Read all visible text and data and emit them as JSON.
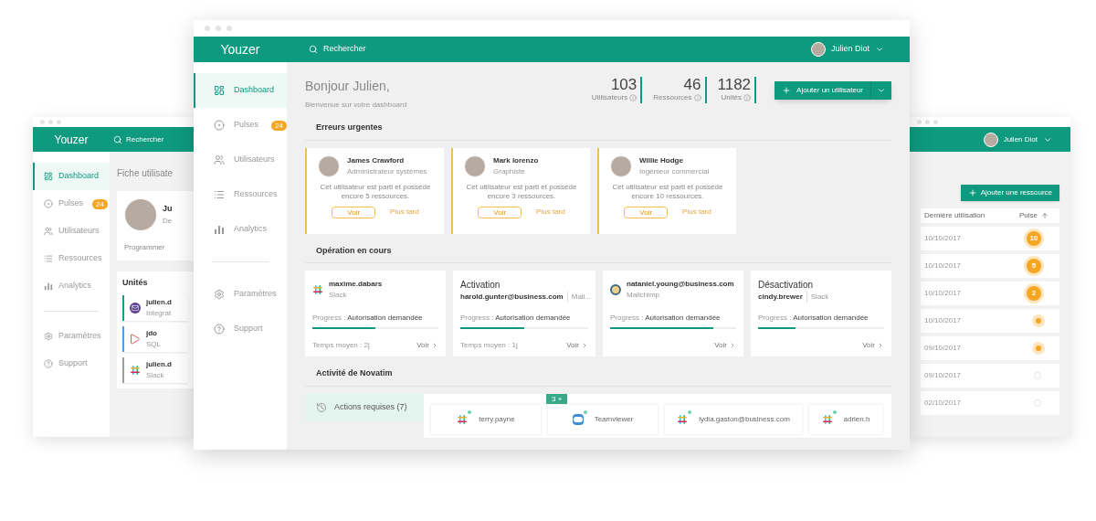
{
  "left_window": {
    "logo": "Youzer",
    "search": "Rechercher",
    "nav": [
      {
        "label": "Dashboard",
        "selected": true
      },
      {
        "label": "Pulses",
        "badge": "24",
        "selected": false
      },
      {
        "label": "Utilisateurs",
        "selected": false
      },
      {
        "label": "Ressources",
        "selected": false
      },
      {
        "label": "Analytics",
        "selected": false
      }
    ],
    "nav_bottom": [
      {
        "label": "Paramètres",
        "selected": false
      },
      {
        "label": "Support",
        "selected": false
      }
    ],
    "page_title": "Fiche utilisate",
    "profile": {
      "name": "Ju",
      "role": "De",
      "action": "Programmer"
    },
    "units_title": "Unités",
    "units": [
      {
        "name": "julien.d",
        "app": "Integrat",
        "color": "#10a37f"
      },
      {
        "name": "jdo",
        "app": "SQL",
        "color": "#4a9ff5"
      },
      {
        "name": "julien.d",
        "app": "Slack",
        "color": "#9e9e9e"
      }
    ]
  },
  "main_window": {
    "logo": "Youzer",
    "search": "Rechercher",
    "user": "Julien Diot",
    "nav": [
      {
        "label": "Dashboard",
        "selected": true
      },
      {
        "label": "Pulses",
        "badge": "24",
        "selected": false
      },
      {
        "label": "Utilisateurs",
        "selected": false
      },
      {
        "label": "Ressources",
        "selected": false
      },
      {
        "label": "Analytics",
        "selected": false
      }
    ],
    "nav_bottom": [
      {
        "label": "Paramètres",
        "selected": false
      },
      {
        "label": "Support",
        "selected": false
      }
    ],
    "greeting": "Bonjour Julien,",
    "subtitle": "Bienvenue sur votre dashboard",
    "stats": [
      {
        "value": "103",
        "label": "Utilisateurs"
      },
      {
        "value": "46",
        "label": "Ressources"
      },
      {
        "value": "1182",
        "label": "Unités"
      }
    ],
    "add_button": "Ajouter un utilisateur",
    "urgent": {
      "title": "Erreurs urgentes",
      "cards": [
        {
          "name": "James Crawford",
          "role": "Administrateur systèmes",
          "message": "Cet utilisateur est parti et possède encore 5 ressources.",
          "primary": "Voir",
          "secondary": "Plus tard"
        },
        {
          "name": "Mark lorenzo",
          "role": "Graphiste",
          "message": "Cet utilisateur est parti et possède encore 3 ressources.",
          "primary": "Voir",
          "secondary": "Plus tard"
        },
        {
          "name": "Willie Hodge",
          "role": "Ingénieur commercial",
          "message": "Cet utilisateur est parti et possède encore 10 ressources.",
          "primary": "Voir",
          "secondary": "Plus tard"
        }
      ]
    },
    "operations": {
      "title": "Opération en cours",
      "cards": [
        {
          "kind": "account",
          "name": "maxime.dabars",
          "app": "Slack",
          "progress_label": "Progress :",
          "progress_value": "Autorisation demandée",
          "level": 0.5,
          "footer": "Temps moyen : 2j",
          "link": "Voir"
        },
        {
          "kind": "titled",
          "title": "Activation",
          "name": "harold.gunter@business.com",
          "app": "Mail...",
          "progress_label": "Progress :",
          "progress_value": "Autorisation demandée",
          "level": 0.5,
          "footer": "Temps moyen : 1j",
          "link": "Voir"
        },
        {
          "kind": "account",
          "name": "nataniel.young@business.com",
          "app": "Mailchimp",
          "progress_label": "Progress :",
          "progress_value": "Autorisation demandée",
          "level": 0.82,
          "link": "Voir"
        },
        {
          "kind": "titled",
          "title": "Désactivation",
          "name": "cindy.brewer",
          "app": "Slack",
          "progress_label": "Progress :",
          "progress_value": "Autorisation demandée",
          "level": 0.3,
          "link": "Voir"
        }
      ]
    },
    "activity": {
      "title": "Activité de Novatim",
      "tabs": [
        {
          "label": "Actions requises (7)",
          "selected": true
        }
      ],
      "cards": [
        {
          "name": "terry.payne"
        },
        {
          "name": "Teamviewer",
          "badge": "3 +"
        },
        {
          "name": "lydia.gaston@business.com"
        },
        {
          "name": "adrien.h"
        }
      ]
    }
  },
  "right_window": {
    "user": "Julien Diot",
    "add_button": "Ajouter une ressource",
    "columns": [
      "Dernière utilisation",
      "Pulse"
    ],
    "rows": [
      {
        "date": "10/10/2017",
        "pulse": {
          "kind": "count",
          "value": "10"
        }
      },
      {
        "date": "10/10/2017",
        "pulse": {
          "kind": "count",
          "value": "5"
        }
      },
      {
        "date": "10/10/2017",
        "pulse": {
          "kind": "count",
          "value": "2"
        }
      },
      {
        "date": "10/10/2017",
        "pulse": {
          "kind": "dot"
        }
      },
      {
        "date": "09/10/2017",
        "pulse": {
          "kind": "dot"
        }
      },
      {
        "date": "09/10/2017",
        "pulse": {
          "kind": "empty"
        }
      },
      {
        "date": "02/10/2017",
        "pulse": {
          "kind": "empty"
        }
      }
    ]
  }
}
